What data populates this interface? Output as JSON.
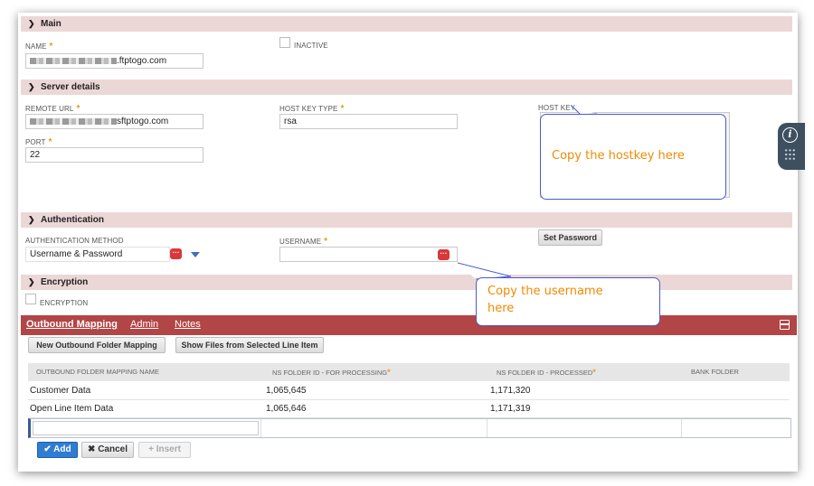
{
  "main_section": {
    "title": "Main"
  },
  "name_field": {
    "label": "NAME",
    "value_suffix": ".ftptogo.com"
  },
  "inactive": {
    "label": "INACTIVE"
  },
  "server_section": {
    "title": "Server details"
  },
  "remote_url": {
    "label": "REMOTE URL",
    "value_suffix": "sftptogo.com"
  },
  "host_key_type": {
    "label": "HOST KEY TYPE",
    "value": "rsa"
  },
  "host_key": {
    "label": "HOST KEY"
  },
  "port": {
    "label": "PORT",
    "value": "22"
  },
  "auth_section": {
    "title": "Authentication"
  },
  "auth_method": {
    "label": "AUTHENTICATION METHOD",
    "value": "Username & Password"
  },
  "username": {
    "label": "USERNAME",
    "value": ""
  },
  "set_password": {
    "label": "Set Password"
  },
  "encryption_section": {
    "title": "Encryption"
  },
  "encryption": {
    "label": "ENCRYPTION"
  },
  "callouts": {
    "hostkey": "Copy the hostkey here",
    "username_line1": "Copy the username",
    "username_line2": "here"
  },
  "tabs": [
    {
      "label": "Outbound Mapping",
      "active": true
    },
    {
      "label": "Admin",
      "active": false
    },
    {
      "label": "Notes",
      "active": false
    }
  ],
  "buttons": {
    "new_mapping": "New Outbound Folder Mapping",
    "show_files": "Show Files from Selected Line Item",
    "add": "Add",
    "cancel": "Cancel",
    "insert": "Insert"
  },
  "table": {
    "columns": [
      "OUTBOUND FOLDER MAPPING NAME",
      "NS FOLDER ID - FOR PROCESSING",
      "NS FOLDER ID - PROCESSED",
      "BANK FOLDER"
    ],
    "rows": [
      [
        "Customer Data",
        "1,065,645",
        "1,171,320",
        ""
      ],
      [
        "Open Line Item Data",
        "1,065,646",
        "1,171,319",
        ""
      ]
    ]
  },
  "colors": {
    "section_bg": "#ecd7d7",
    "tab_bar": "#b24545",
    "required": "#e69b1f",
    "callout_text": "#f08a00",
    "callout_border": "#4a5bd0",
    "add_button": "#2f7dd3"
  }
}
